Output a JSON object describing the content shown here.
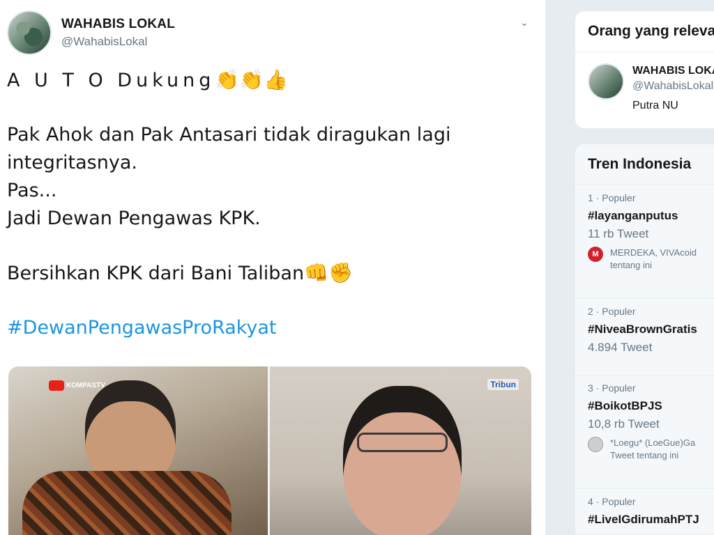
{
  "tweet": {
    "author_name": "WAHABIS LOKAL",
    "author_handle": "@WahabisLokal",
    "line1_text": "A U T O  Dukung",
    "line1_emoji": "👏👏👍",
    "line2": "Pak Ahok dan Pak Antasari tidak diragukan lagi",
    "line3": "integritasnya.",
    "line4": "Pas...",
    "line5": "Jadi Dewan Pengawas KPK.",
    "line6_text": "Bersihkan KPK dari Bani Taliban",
    "line6_emoji": "👊✊",
    "hashtag": "#DewanPengawasProRakyat",
    "media": {
      "left_logo": "KOMPASTV",
      "right_logo": "Tribun"
    }
  },
  "sidebar": {
    "related": {
      "title": "Orang yang relevan",
      "user_name": "WAHABIS LOKAL",
      "user_handle": "@WahabisLokal",
      "user_bio": "Putra NU"
    },
    "trends": {
      "title": "Tren Indonesia",
      "items": [
        {
          "meta": "1 · Populer",
          "name": "#layanganputus",
          "count": "11 rb Tweet",
          "ctx_line1": "MERDEKA, VIVAcoid",
          "ctx_line2": "tentang ini",
          "ctx_icon": "M"
        },
        {
          "meta": "2 · Populer",
          "name": "#NiveaBrownGratis",
          "count": "4.894 Tweet"
        },
        {
          "meta": "3 · Populer",
          "name": "#BoikotBPJS",
          "count": "10,8 rb Tweet",
          "ctx_line1": "*Loegu* (LoeGue)Ga",
          "ctx_line2": "Tweet tentang ini"
        },
        {
          "meta": "4 · Populer",
          "name": "#LiveIGdirumahPTJ"
        }
      ]
    }
  }
}
